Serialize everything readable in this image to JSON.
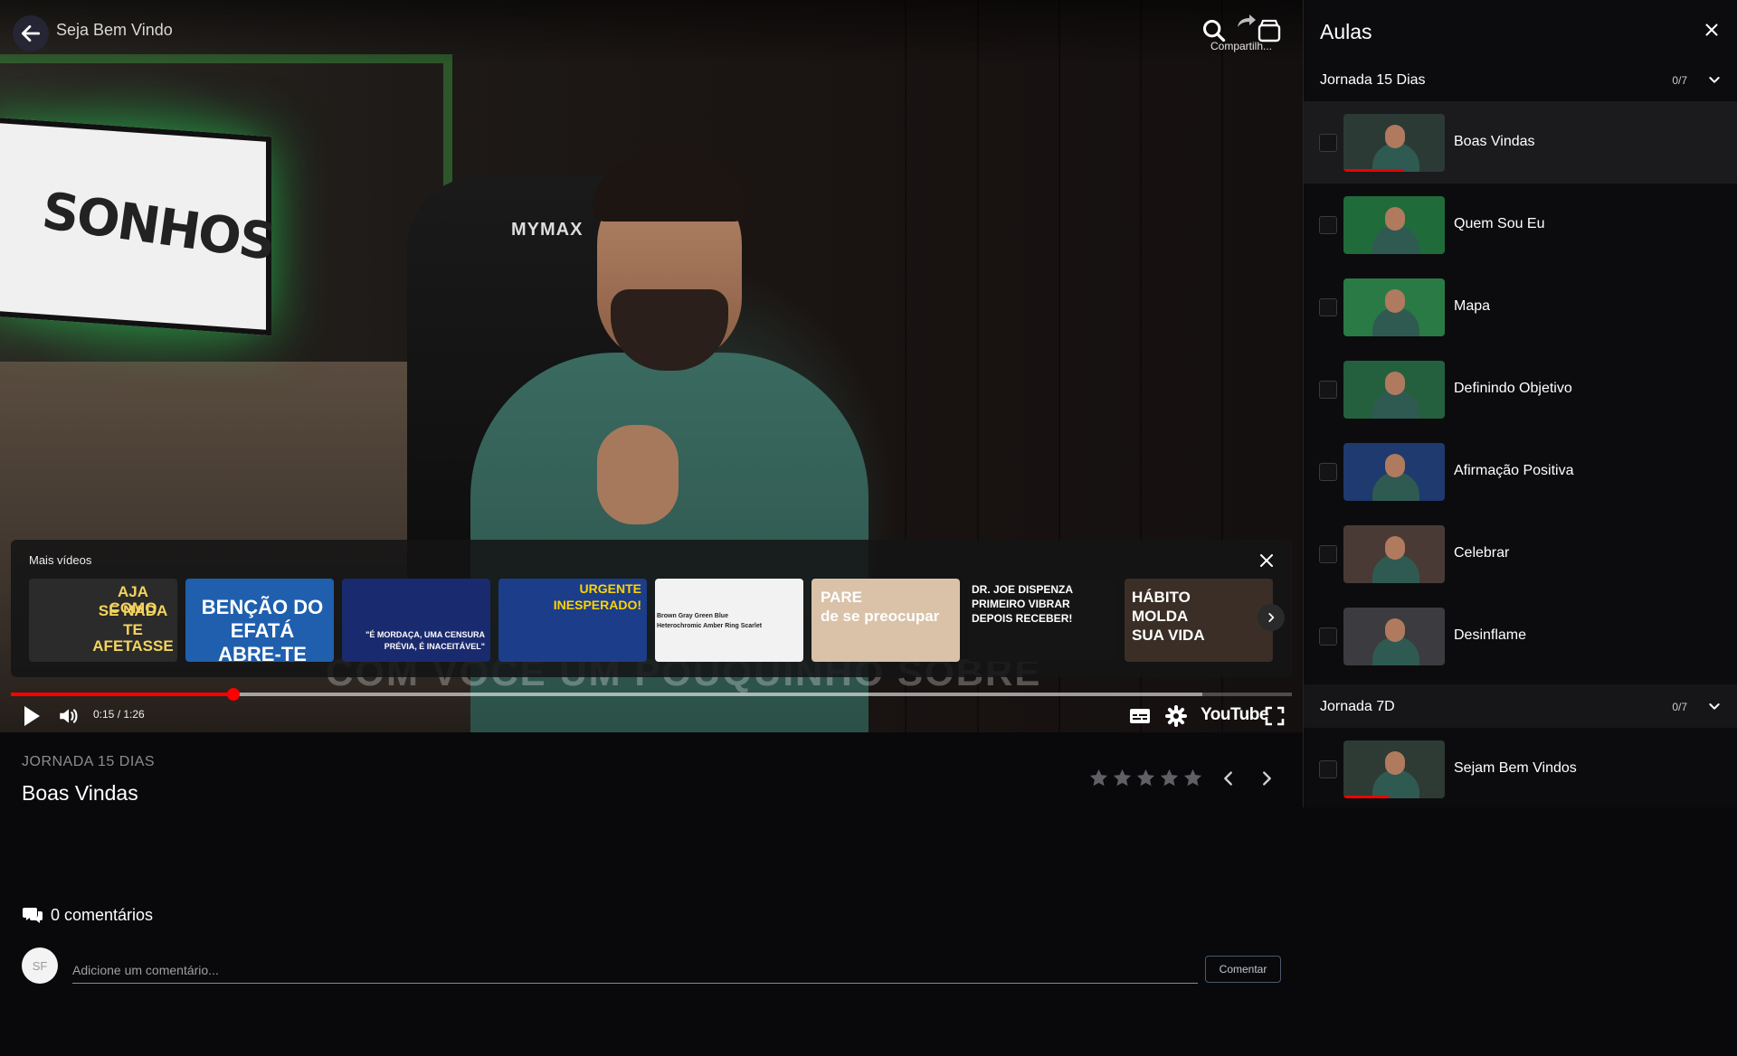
{
  "header": {
    "title": "Seja Bem Vindo",
    "share_label": "Compartilh..."
  },
  "player": {
    "subtitle_text": "COM VOCÊ UM POUQUINHO SOBRE",
    "more_videos": {
      "title": "Mais vídeos",
      "items": [
        {
          "lines": [
            "AJA COMO",
            "SE NADA",
            "TE AFETASSE"
          ],
          "bg": "#2b2b2b",
          "color": "#f4d35e"
        },
        {
          "lines": [
            "BENÇÃO DO",
            "EFATÁ",
            "ABRE-TE"
          ],
          "bg": "#1f5fae",
          "color": "#ffffff"
        },
        {
          "lines": [
            "\"É MORDAÇA, UMA CENSURA",
            "PRÉVIA, É INACEITÁVEL\""
          ],
          "bg": "#1a2a6e",
          "color": "#ffffff"
        },
        {
          "lines": [
            "URGENTE",
            "INESPERADO!"
          ],
          "bg": "#1c3d8a",
          "color": "#ffd400"
        },
        {
          "lines": [
            "Brown  Gray  Green  Blue",
            "Heterochromic  Amber  Ring  Scarlet"
          ],
          "bg": "#f2f2f2",
          "color": "#222222"
        },
        {
          "lines": [
            "PARE",
            "de se preocupar"
          ],
          "bg": "#d9c2a8",
          "color": "#ffffff"
        },
        {
          "lines": [
            "DR. JOE DISPENZA",
            "PRIMEIRO VIBRAR",
            "DEPOIS RECEBER!"
          ],
          "bg": "#151515",
          "color": "#ffffff"
        },
        {
          "lines": [
            "HÁBITO",
            "MOLDA",
            "SUA VIDA"
          ],
          "bg": "#3a2e26",
          "color": "#ffffff"
        }
      ]
    },
    "time_display": "0:15 / 1:26",
    "progress_played": 0.174,
    "progress_loaded": 0.93,
    "youtube_label": "YouTube"
  },
  "lesson": {
    "course_name": "JORNADA 15 DIAS",
    "title": "Boas Vindas",
    "rating": 0,
    "max_rating": 5
  },
  "comments": {
    "header": "0 comentários",
    "avatar_initials": "SF",
    "input_placeholder": "Adicione um comentário...",
    "submit_label": "Comentar"
  },
  "sidebar": {
    "title": "Aulas",
    "modules": [
      {
        "name": "Jornada 15 Dias",
        "progress": "0/7",
        "lessons": [
          {
            "label": "Boas Vindas",
            "active": true,
            "watched": 0.6,
            "thumb_bg": "#2c3a36"
          },
          {
            "label": "Quem Sou Eu",
            "active": false,
            "watched": 0,
            "thumb_bg": "#1f6b3a"
          },
          {
            "label": "Mapa",
            "active": false,
            "watched": 0,
            "thumb_bg": "#2a7a45"
          },
          {
            "label": "Definindo Objetivo",
            "active": false,
            "watched": 0,
            "thumb_bg": "#24603e"
          },
          {
            "label": "Afirmação Positiva",
            "active": false,
            "watched": 0,
            "thumb_bg": "#1e3a6e"
          },
          {
            "label": "Celebrar",
            "active": false,
            "watched": 0,
            "thumb_bg": "#4a3a36"
          },
          {
            "label": "Desinflame",
            "active": false,
            "watched": 0,
            "thumb_bg": "#3b3b40"
          }
        ]
      },
      {
        "name": "Jornada 7D",
        "progress": "0/7",
        "lessons": [
          {
            "label": "Sejam Bem Vindos",
            "active": false,
            "watched": 0.45,
            "thumb_bg": "#2e3a34"
          }
        ]
      }
    ]
  },
  "colors": {
    "accent": "#ff0000",
    "background": "#09090b",
    "sidebar_background": "#0c0c0e"
  }
}
